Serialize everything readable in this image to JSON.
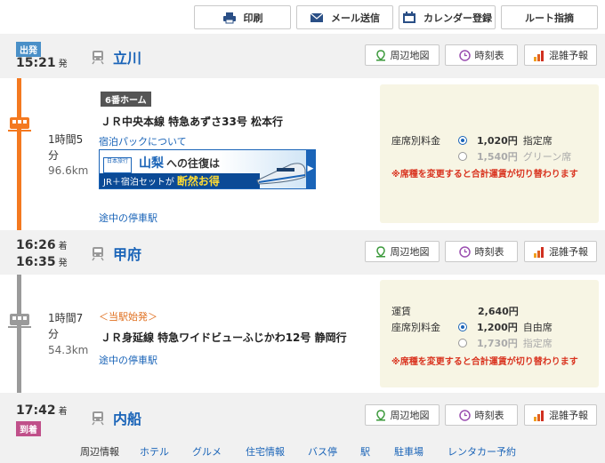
{
  "toolbar": {
    "print": "印刷",
    "email": "メール送信",
    "calendar": "カレンダー登録",
    "route": "ルート指摘"
  },
  "station_buttons": {
    "map": "周辺地図",
    "timetable": "時刻表",
    "crowd": "混雑予報"
  },
  "stations": [
    {
      "badge": "出発",
      "time1": "15:21",
      "suffix1": "発",
      "name": "立川"
    },
    {
      "time1": "16:26",
      "suffix1": "着",
      "time2": "16:35",
      "suffix2": "発",
      "name": "甲府"
    },
    {
      "time1": "17:42",
      "suffix1": "着",
      "badge": "到着",
      "name": "内船"
    }
  ],
  "segments": [
    {
      "platform": "6番ホーム",
      "train": "ＪＲ中央本線 特急あずさ33号 松本行",
      "link_pack": "宿泊パックについて",
      "duration_line1": "1時間5",
      "duration_line2": "分",
      "distance": "96.6km",
      "stops_link": "途中の停車駅",
      "banner": {
        "brand": "日本旅行",
        "title_a": "山梨",
        "title_b": "への往復は",
        "sub_a": "JR＋宿泊セットが",
        "sub_b": "断然お得"
      },
      "fare": {
        "seat_label": "座席別料金",
        "opt1_price": "1,020円",
        "opt1_type": "指定席",
        "opt2_price": "1,540円",
        "opt2_type": "グリーン席",
        "warning": "※席種を変更すると合計運賃が切り替わります"
      }
    },
    {
      "origin_note": "＜当駅始発＞",
      "train": "ＪＲ身延線 特急ワイドビューふじかわ12号 静岡行",
      "duration_line1": "1時間7",
      "duration_line2": "分",
      "distance": "54.3km",
      "stops_link": "途中の停車駅",
      "fare": {
        "fare_label": "運賃",
        "fare_price": "2,640円",
        "seat_label": "座席別料金",
        "opt1_price": "1,200円",
        "opt1_type": "自由席",
        "opt2_price": "1,730円",
        "opt2_type": "指定席",
        "warning": "※席種を変更すると合計運賃が切り替わります"
      }
    }
  ],
  "footer": {
    "label": "周辺情報",
    "links": [
      "ホテル",
      "グルメ",
      "住宅情報",
      "バス停",
      "駅",
      "駐車場",
      "レンタカー予約"
    ]
  },
  "colors": {
    "line1": "#f47920",
    "line2": "#9a9a9a",
    "link": "#1a64b8",
    "warning": "#d9331f",
    "badge_depart": "#4a90c8",
    "badge_arrive": "#c0508a"
  }
}
